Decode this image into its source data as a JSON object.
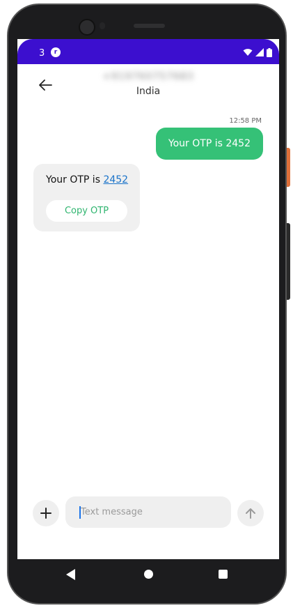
{
  "status_bar": {
    "notification_count": "3",
    "app_icon_label": "r",
    "icons": [
      "wifi-icon",
      "signal-icon",
      "battery-icon"
    ],
    "background_color": "#3c0fcf"
  },
  "header": {
    "contact_number": "+919760757683",
    "contact_country": "India",
    "back_icon": "back-arrow-icon"
  },
  "conversation": {
    "timestamp": "12:58 PM",
    "outgoing_message": "Your OTP is 2452",
    "incoming_message": {
      "text_prefix": "Your OTP is ",
      "otp_code": "2452",
      "copy_button_label": "Copy OTP"
    },
    "outgoing_color": "#35c177"
  },
  "composer": {
    "placeholder": "Text message",
    "value": "",
    "add_icon": "plus-icon",
    "send_icon": "send-arrow-icon"
  },
  "nav_bar": {
    "icons": [
      "nav-back-icon",
      "nav-home-icon",
      "nav-recents-icon"
    ]
  }
}
